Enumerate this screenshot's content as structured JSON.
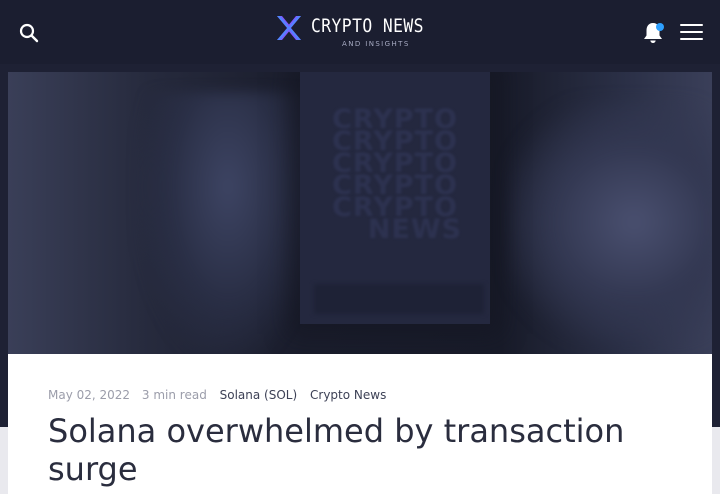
{
  "header": {
    "logo_title": "CRYPTO NEWS",
    "logo_tagline": "AND INSIGHTS",
    "icons": {
      "search": "search-icon",
      "logo": "crypto-news-logo-icon",
      "notifications": "bell-icon",
      "menu": "hamburger-menu-icon"
    },
    "notification_dot_color": "#2ea0ff"
  },
  "hero": {
    "words": [
      "CRYPTO",
      "CRYPTO",
      "CRYPTO",
      "CRYPTO",
      "CRYPTO",
      "NEWS"
    ]
  },
  "article": {
    "date": "May 02, 2022",
    "read_time": "3 min read",
    "tags": [
      "Solana (SOL)",
      "Crypto News"
    ],
    "title": "Solana overwhelmed by transaction surge"
  },
  "colors": {
    "header_bg": "#1b1e30",
    "brand_accent_blue": "#4a8dff",
    "brand_accent_purple": "#7b5cff"
  }
}
